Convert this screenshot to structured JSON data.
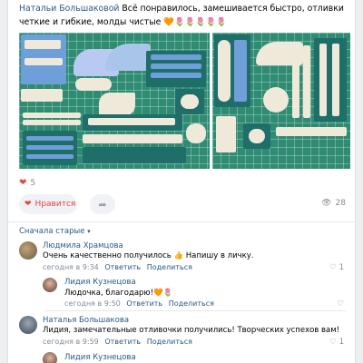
{
  "post": {
    "author_link": "Натальи Большаковой",
    "text": " Всё понравилось, замешивается быстро, отливки четкие и гибкие, молды чистые ",
    "emoji_heart": "🧡",
    "emoji_tulips": "🌷🌷🌷🌷🌷"
  },
  "stats": {
    "likes_count": "5",
    "like_label": "Нравится",
    "views_count": "28"
  },
  "comments_sort": {
    "label": "Сначала старые"
  },
  "comments": [
    {
      "name": "Людмила Храмцова",
      "text": "Очень качественно получилось 👍 Напишу в личку.",
      "time": "сегодня в 9:34",
      "reply": "Ответить",
      "share": "Поделиться",
      "likes": "1"
    },
    {
      "name": "Лидия Кузнецова",
      "text": "Людочка, благодарю!🧡🌷",
      "time": "сегодня в 9:50",
      "reply": "Ответить",
      "share": "Поделиться",
      "likes": ""
    },
    {
      "name": "Наталья Большакова",
      "text": "Лидия, замечательные отливочки получились! Творческих успехов вам!",
      "time": "сегодня в 9:59",
      "reply": "Ответить",
      "share": "Поделиться",
      "likes": "1"
    },
    {
      "name": "Лидия Кузнецова",
      "text": "",
      "time": "",
      "reply": "",
      "share": "",
      "likes": ""
    }
  ],
  "colors": {
    "link": "#2a5885",
    "like_red": "#e64646",
    "meta_gray": "#818c99"
  }
}
